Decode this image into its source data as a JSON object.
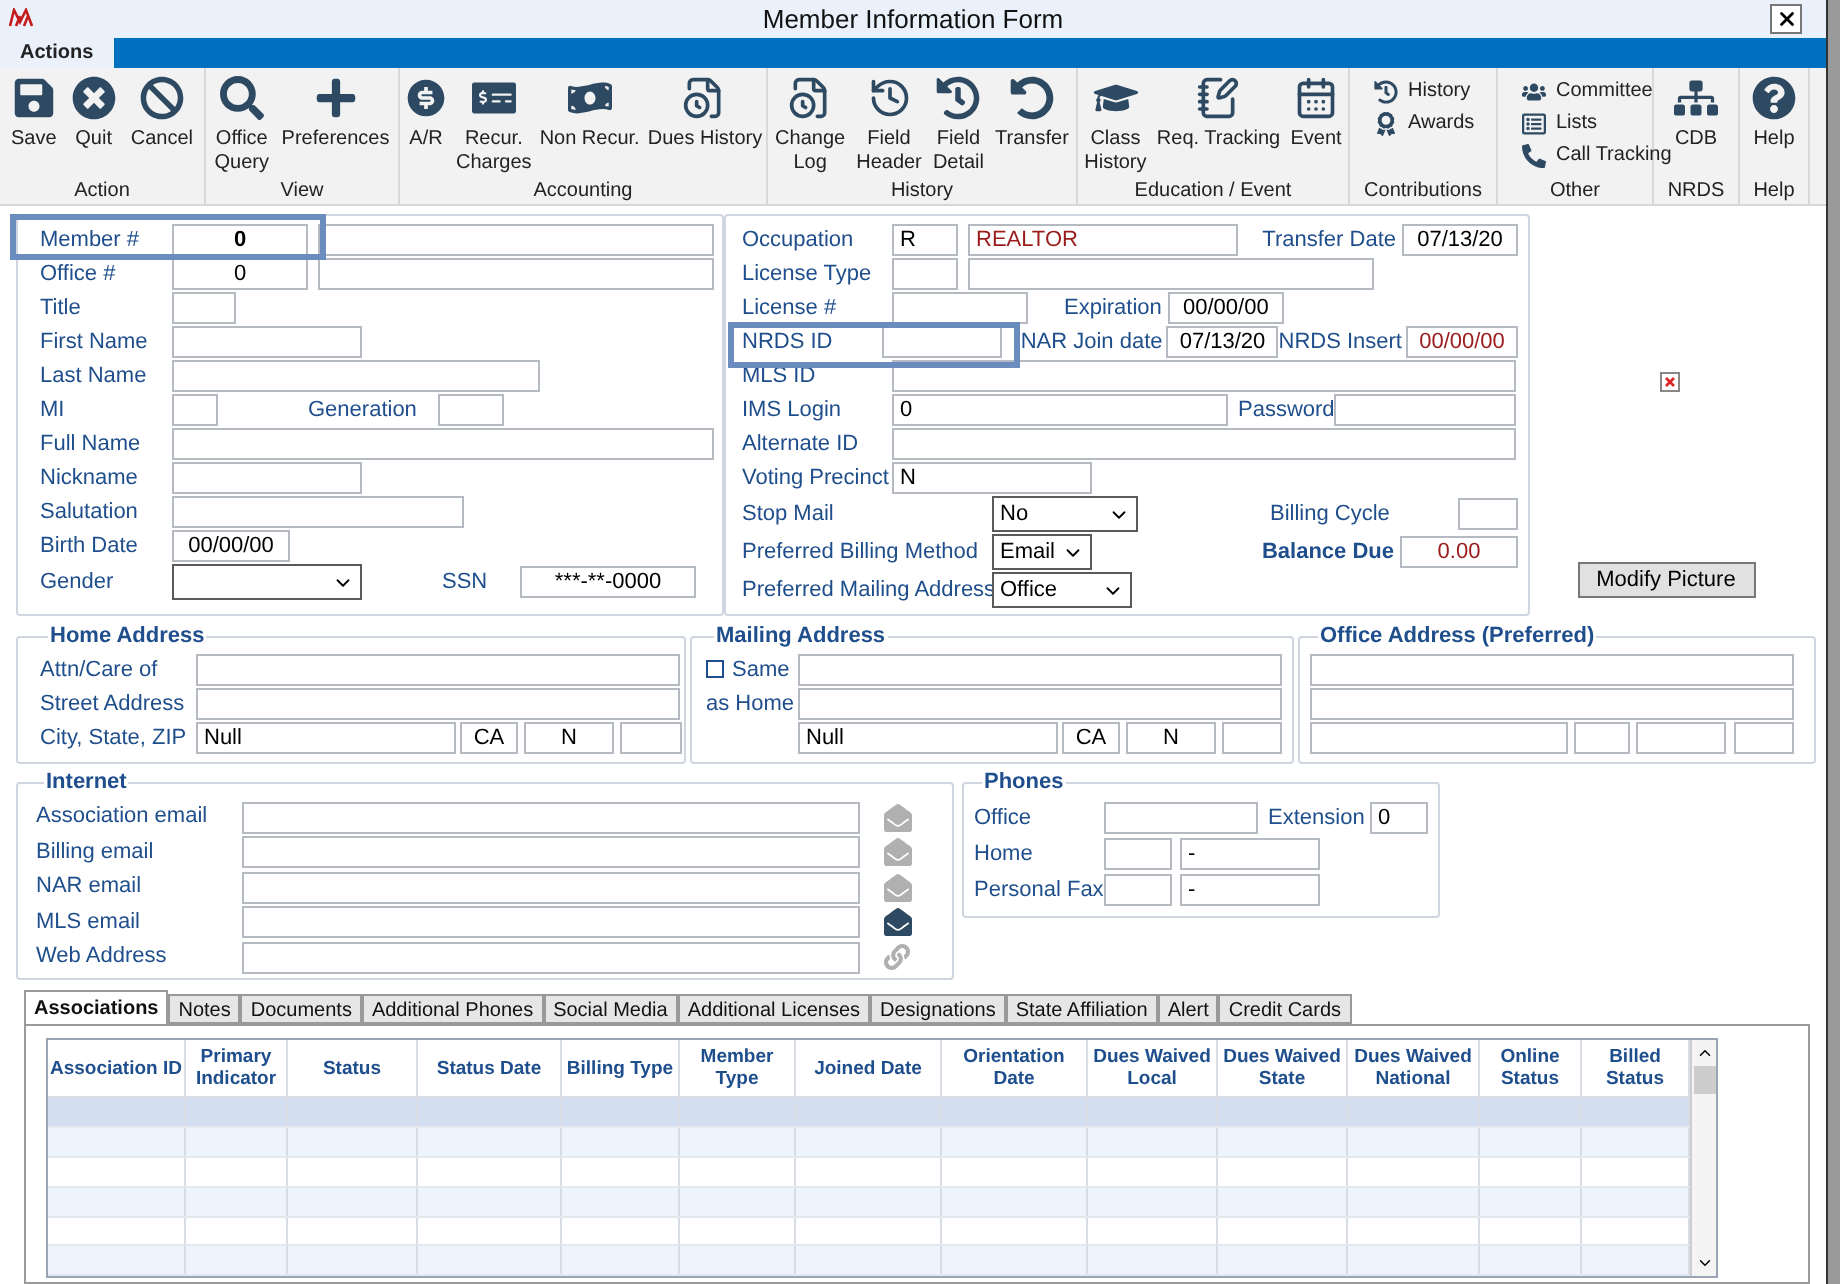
{
  "window": {
    "title": "Member Information Form"
  },
  "ribbon": {
    "tabs": [
      {
        "label": "Actions",
        "selected": true
      }
    ],
    "groups": [
      {
        "label": "Action",
        "buttons": [
          {
            "lines": [
              "Save"
            ],
            "kind": "large"
          },
          {
            "lines": [
              "Quit"
            ],
            "kind": "large"
          },
          {
            "lines": [
              "Cancel"
            ],
            "kind": "large"
          }
        ]
      },
      {
        "label": "View",
        "buttons": [
          {
            "lines": [
              "Office",
              "Query"
            ],
            "kind": "large"
          },
          {
            "lines": [
              "Preferences"
            ],
            "kind": "large"
          }
        ]
      },
      {
        "label": "Accounting",
        "buttons": [
          {
            "lines": [
              "A/R"
            ],
            "kind": "large"
          },
          {
            "lines": [
              "Recur.",
              "Charges"
            ],
            "kind": "large"
          },
          {
            "lines": [
              "Non Recur."
            ],
            "kind": "large"
          },
          {
            "lines": [
              "Dues History"
            ],
            "kind": "large"
          }
        ]
      },
      {
        "label": "History",
        "buttons": [
          {
            "lines": [
              "Change",
              "Log"
            ],
            "kind": "large"
          },
          {
            "lines": [
              "Field",
              "Header"
            ],
            "kind": "large"
          },
          {
            "lines": [
              "Field",
              "Detail"
            ],
            "kind": "large"
          },
          {
            "lines": [
              "Transfer"
            ],
            "kind": "large"
          }
        ]
      },
      {
        "label": "Education / Event",
        "buttons": [
          {
            "lines": [
              "Class",
              "History"
            ],
            "kind": "large"
          },
          {
            "lines": [
              "Req. Tracking"
            ],
            "kind": "large"
          },
          {
            "lines": [
              "Event"
            ],
            "kind": "large"
          }
        ]
      },
      {
        "label": "Contributions",
        "buttons": [
          {
            "lines": [
              "History"
            ],
            "kind": "small"
          },
          {
            "lines": [
              "Awards"
            ],
            "kind": "small"
          }
        ]
      },
      {
        "label": "Other",
        "buttons": [
          {
            "lines": [
              "Committee"
            ],
            "kind": "small"
          },
          {
            "lines": [
              "Lists"
            ],
            "kind": "small"
          },
          {
            "lines": [
              "Call Tracking"
            ],
            "kind": "small"
          }
        ]
      },
      {
        "label": "NRDS",
        "buttons": [
          {
            "lines": [
              "CDB"
            ],
            "kind": "large"
          }
        ]
      },
      {
        "label": "Help",
        "buttons": [
          {
            "lines": [
              "Help"
            ],
            "kind": "large"
          }
        ]
      }
    ]
  },
  "personal": {
    "member_no": {
      "label": "Member #",
      "value": "0"
    },
    "office_no": {
      "label": "Office #",
      "value": "0"
    },
    "title": {
      "label": "Title"
    },
    "first_name": {
      "label": "First Name"
    },
    "last_name": {
      "label": "Last Name"
    },
    "mi": {
      "label": "MI"
    },
    "generation": {
      "label": "Generation"
    },
    "full_name": {
      "label": "Full Name"
    },
    "nickname": {
      "label": "Nickname"
    },
    "salutation": {
      "label": "Salutation"
    },
    "birth_date": {
      "label": "Birth Date",
      "value": "00/00/00"
    },
    "gender": {
      "label": "Gender"
    },
    "ssn": {
      "label": "SSN",
      "value": "***-**-0000"
    }
  },
  "membership": {
    "occupation": {
      "label": "Occupation",
      "code": "R",
      "name": "REALTOR"
    },
    "transfer_date": {
      "label": "Transfer Date",
      "value": "07/13/20"
    },
    "license_type": {
      "label": "License Type"
    },
    "license_no": {
      "label": "License #"
    },
    "expiration": {
      "label": "Expiration",
      "value": "00/00/00"
    },
    "nrds_id": {
      "label": "NRDS ID"
    },
    "nar_join_date": {
      "label": "NAR Join date",
      "value": "07/13/20"
    },
    "nrds_insert": {
      "label": "NRDS Insert",
      "value": "00/00/00"
    },
    "mls_id": {
      "label": "MLS ID"
    },
    "ims_login": {
      "label": "IMS Login",
      "value": "0"
    },
    "password": {
      "label": "Password"
    },
    "alternate_id": {
      "label": "Alternate ID"
    },
    "voting_precinct": {
      "label": "Voting Precinct",
      "value": "N"
    },
    "stop_mail": {
      "label": "Stop Mail",
      "value": "No"
    },
    "billing_cycle": {
      "label": "Billing Cycle"
    },
    "preferred_billing_method": {
      "label": "Preferred Billing Method",
      "value": "Email"
    },
    "balance_due": {
      "label": "Balance Due",
      "value": "0.00"
    },
    "preferred_mailing_address": {
      "label": "Preferred Mailing Address",
      "value": "Office"
    }
  },
  "picture": {
    "button": "Modify Picture"
  },
  "home_address": {
    "title": "Home Address",
    "attn_label": "Attn/Care of",
    "street_label": "Street Address",
    "city_label": "City, State, ZIP",
    "city": "Null",
    "state": "CA",
    "zip": "N"
  },
  "mailing_address": {
    "title": "Mailing Address",
    "same_label": "Same",
    "as_home_label": "as Home",
    "same_as_home": false,
    "city": "Null",
    "state": "CA",
    "zip": "N"
  },
  "office_address": {
    "title": "Office Address (Preferred)"
  },
  "internet": {
    "title": "Internet",
    "rows": [
      {
        "label": "Association email",
        "kind": "email",
        "active": false
      },
      {
        "label": "Billing email",
        "kind": "email",
        "active": false
      },
      {
        "label": "NAR email",
        "kind": "email",
        "active": false
      },
      {
        "label": "MLS email",
        "kind": "email",
        "active": true
      },
      {
        "label": "Web Address",
        "kind": "link",
        "active": false
      }
    ]
  },
  "phones": {
    "title": "Phones",
    "office_label": "Office",
    "extension_label": "Extension",
    "extension": "0",
    "home_label": "Home",
    "home": "-",
    "fax_label": "Personal Fax",
    "fax": "-"
  },
  "tabs": [
    {
      "label": "Associations",
      "selected": true
    },
    {
      "label": "Notes",
      "selected": false
    },
    {
      "label": "Documents",
      "selected": false
    },
    {
      "label": "Additional Phones",
      "selected": false
    },
    {
      "label": "Social Media",
      "selected": false
    },
    {
      "label": "Additional Licenses",
      "selected": false
    },
    {
      "label": "Designations",
      "selected": false
    },
    {
      "label": "State Affiliation",
      "selected": false
    },
    {
      "label": "Alert",
      "selected": false
    },
    {
      "label": "Credit Cards",
      "selected": false
    }
  ],
  "grid": {
    "columns": [
      "Association ID",
      "Primary Indicator",
      "Status",
      "Status Date",
      "Billing Type",
      "Member Type",
      "Joined Date",
      "Orientation Date",
      "Dues Waived Local",
      "Dues Waived State",
      "Dues Waived National",
      "Online Status",
      "Billed Status"
    ],
    "rows": [
      {
        "selected": true
      },
      {
        "selected": false
      },
      {
        "selected": false
      },
      {
        "selected": false
      },
      {
        "selected": false
      },
      {
        "selected": false
      }
    ]
  }
}
